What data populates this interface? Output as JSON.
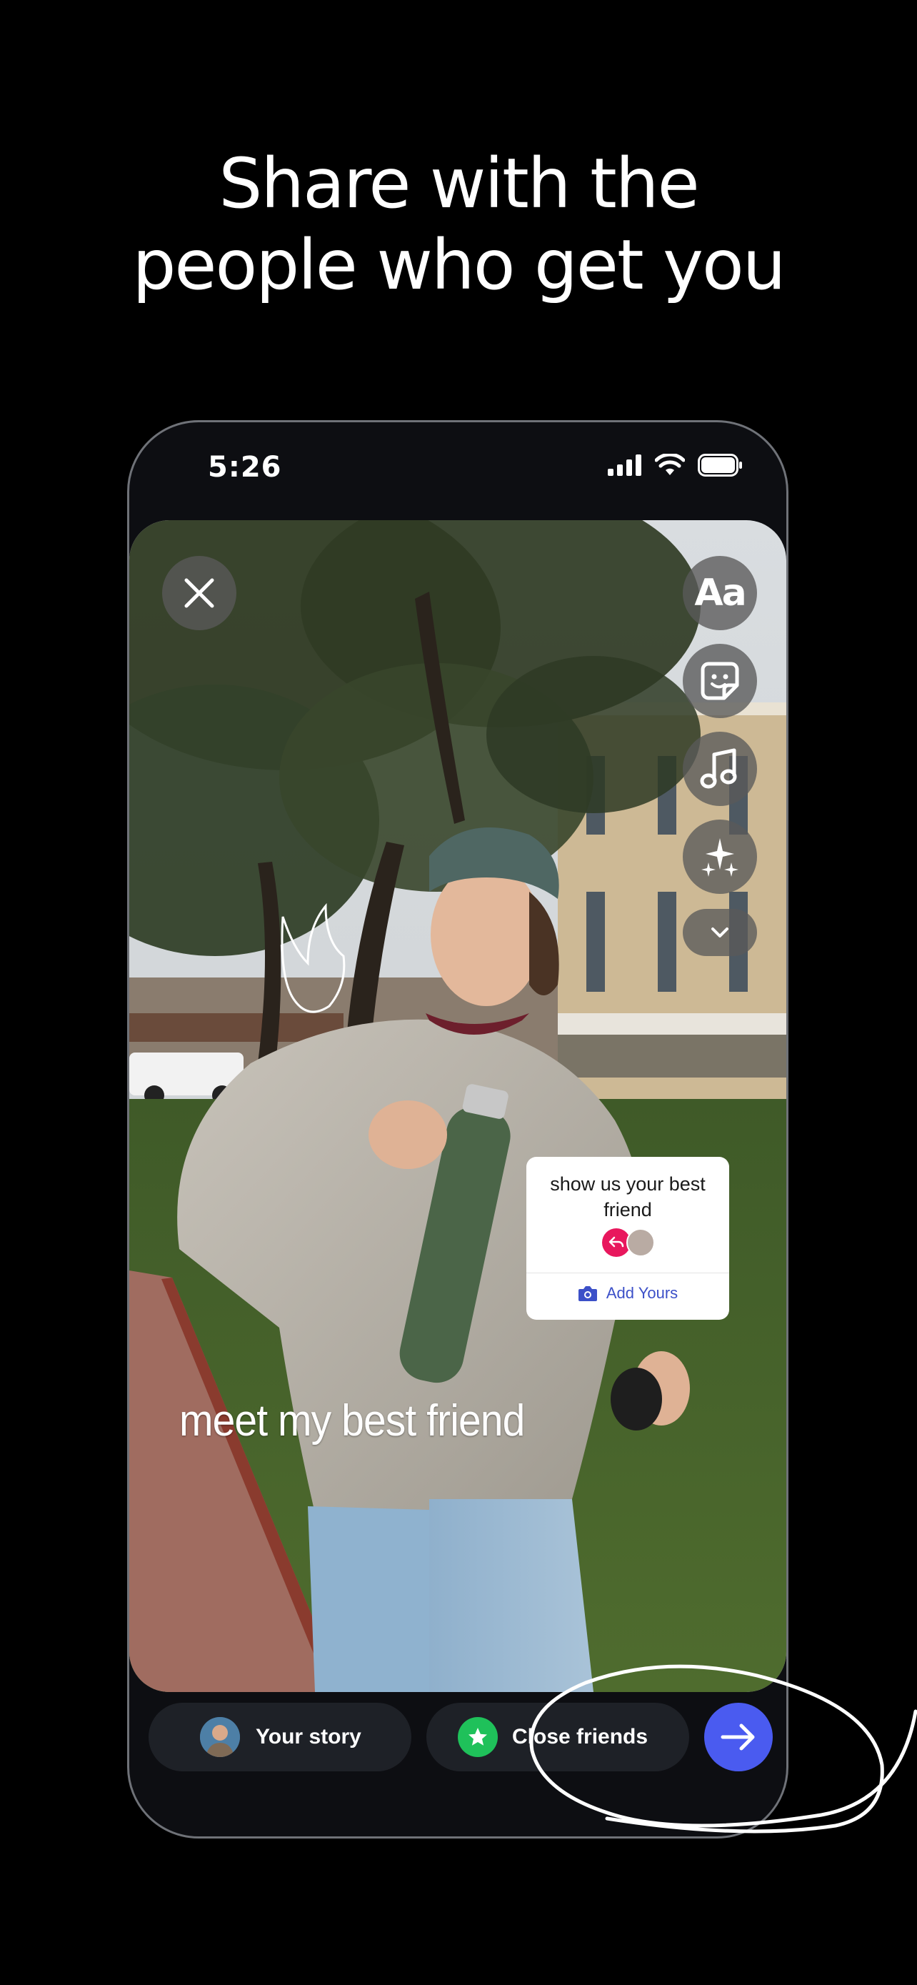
{
  "headline": {
    "line1": "Share with the",
    "line2": "people who get you"
  },
  "status_bar": {
    "time": "5:26"
  },
  "story_editor": {
    "caption": "meet my best friend",
    "tools": [
      "close-icon",
      "text-tool-icon",
      "sticker-icon",
      "music-icon",
      "effects-icon",
      "chevron-down-icon"
    ],
    "text_tool_label": "Aa",
    "sticker": {
      "prompt": "show us your best friend",
      "action_label": "Add Yours"
    }
  },
  "share_bar": {
    "your_story_label": "Your story",
    "close_friends_label": "Close friends",
    "send_icon": "arrow-right-icon"
  },
  "colors": {
    "send_button": "#4a5bf0",
    "close_friends_star": "#1fc15a",
    "sticker_accent": "#e8175d",
    "add_yours_link": "#3c50c8"
  }
}
